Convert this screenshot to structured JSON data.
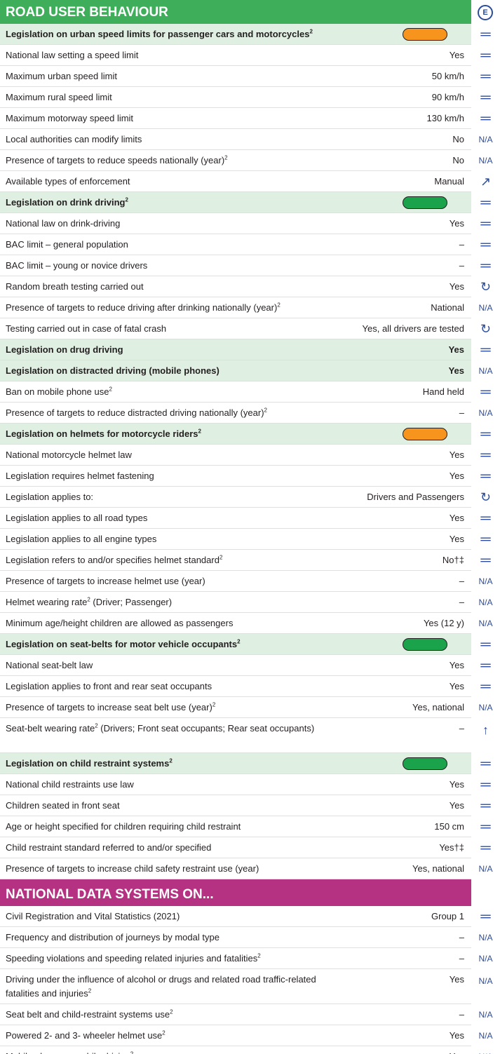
{
  "section1": {
    "title": "ROAD USER BEHAVIOUR",
    "badge": "E",
    "rows": [
      {
        "label": "Legislation on urban speed limits for passenger cars and motorcycles",
        "sup": "2",
        "value": "",
        "header": true,
        "pill": "#f7941d",
        "trend": "eq"
      },
      {
        "label": "National law setting a speed limit",
        "value": "Yes",
        "trend": "eq"
      },
      {
        "label": "Maximum urban speed limit",
        "value": "50 km/h",
        "trend": "eq"
      },
      {
        "label": "Maximum rural speed limit",
        "value": "90 km/h",
        "trend": "eq"
      },
      {
        "label": "Maximum motorway speed limit",
        "value": "130 km/h",
        "trend": "eq"
      },
      {
        "label": "Local authorities can modify limits",
        "value": "No",
        "trend": "na"
      },
      {
        "label": "Presence of targets to reduce speeds nationally (year)",
        "sup": "2",
        "value": "No",
        "trend": "na"
      },
      {
        "label": "Available types of enforcement",
        "value": "Manual",
        "trend": "diag"
      },
      {
        "label": "Legislation on drink driving",
        "sup": "2",
        "value": "",
        "header": true,
        "pill": "#1aa34a",
        "trend": "eq"
      },
      {
        "label": "National law on drink-driving",
        "value": "Yes",
        "trend": "eq"
      },
      {
        "label": "BAC limit – general population",
        "value": "–",
        "trend": "eq"
      },
      {
        "label": "BAC limit – young or novice drivers",
        "value": "–",
        "trend": "eq"
      },
      {
        "label": "Random breath testing carried out",
        "value": "Yes",
        "trend": "cycle"
      },
      {
        "label": "Presence of targets to reduce driving after drinking nationally (year)",
        "sup": "2",
        "value": "National",
        "trend": "na"
      },
      {
        "label": "Testing carried out in case of fatal crash",
        "value": "Yes, all drivers are tested",
        "trend": "cycle"
      },
      {
        "label": "Legislation on drug driving",
        "value": "Yes",
        "header": true,
        "trend": "eq"
      },
      {
        "label": "Legislation on distracted driving (mobile phones)",
        "value": "Yes",
        "header": true,
        "trend": "na"
      },
      {
        "label": "Ban on mobile phone use",
        "sup": "2",
        "value": "Hand held",
        "trend": "eq"
      },
      {
        "label": "Presence of targets to reduce distracted driving nationally (year)",
        "sup": "2",
        "value": "–",
        "trend": "na"
      },
      {
        "label": "Legislation on helmets for motorcycle riders",
        "sup": "2",
        "value": "",
        "header": true,
        "pill": "#f7941d",
        "trend": "eq"
      },
      {
        "label": "National motorcycle helmet law",
        "value": "Yes",
        "trend": "eq"
      },
      {
        "label": "Legislation requires helmet fastening",
        "value": "Yes",
        "trend": "eq"
      },
      {
        "label": "Legislation applies to:",
        "value": "Drivers and Passengers",
        "trend": "cycle"
      },
      {
        "label": "Legislation applies to all road types",
        "value": "Yes",
        "trend": "eq"
      },
      {
        "label": "Legislation applies to all engine types",
        "value": "Yes",
        "trend": "eq"
      },
      {
        "label": "Legislation refers to and/or specifies helmet standard",
        "sup": "2",
        "value": "No†‡",
        "trend": "eq"
      },
      {
        "label": "Presence of targets to increase helmet use (year)",
        "value": "–",
        "trend": "na"
      },
      {
        "label": "Helmet wearing rate",
        "sup": "2",
        "labelTail": " (Driver; Passenger)",
        "value": "–",
        "trend": "na"
      },
      {
        "label": "Minimum age/height children are allowed as passengers",
        "value": "Yes (12 y)",
        "trend": "na"
      },
      {
        "label": "Legislation on seat-belts for motor vehicle occupants",
        "sup": "2",
        "value": "",
        "header": true,
        "pill": "#1aa34a",
        "trend": "eq"
      },
      {
        "label": "National seat-belt law",
        "value": "Yes",
        "trend": "eq"
      },
      {
        "label": "Legislation applies to front and rear seat occupants",
        "value": "Yes",
        "trend": "eq"
      },
      {
        "label": "Presence of targets to increase seat belt use (year)",
        "sup": "2",
        "value": "Yes, national",
        "trend": "na"
      },
      {
        "label": "Seat-belt wearing rate",
        "sup": "2",
        "labelTail": " (Drivers; Front seat occupants; Rear seat occupants)",
        "value": "–",
        "trend": "up",
        "multi": true
      },
      {
        "label": "Legislation on child restraint systems",
        "sup": "2",
        "value": "",
        "header": true,
        "pill": "#1aa34a",
        "trend": "eq"
      },
      {
        "label": "National child restraints use law",
        "value": "Yes",
        "trend": "eq"
      },
      {
        "label": "Children seated in front seat",
        "value": "Yes",
        "trend": "eq"
      },
      {
        "label": "Age or height specified for children requiring child restraint",
        "value": "150 cm",
        "trend": "eq"
      },
      {
        "label": "Child restraint standard referred to and/or specified",
        "value": "Yes†‡",
        "trend": "eq"
      },
      {
        "label": "Presence of targets to increase child safety restraint use (year)",
        "value": "Yes, national",
        "trend": "na"
      }
    ]
  },
  "section2": {
    "title": "NATIONAL DATA SYSTEMS ON...",
    "rows": [
      {
        "label": "Civil Registration and Vital Statistics (2021)",
        "value": "Group 1",
        "trend": "eq"
      },
      {
        "label": "Frequency and distribution of journeys by modal type",
        "value": "–",
        "trend": "na"
      },
      {
        "label": "Speeding violations and speeding related injuries and fatalities",
        "sup": "2",
        "value": "–",
        "trend": "na"
      },
      {
        "label": "Driving under the influence of alcohol or drugs  and related road traffic-related fatalities and injuries",
        "sup": "2",
        "value": "Yes",
        "trend": "na",
        "multi": true
      },
      {
        "label": "Seat belt and child-restraint systems use",
        "sup": "2",
        "value": "–",
        "trend": "na"
      },
      {
        "label": "Powered 2- and 3- wheeler helmet use",
        "sup": "2",
        "value": "Yes",
        "trend": "na"
      },
      {
        "label": "Mobile phone use while driving",
        "sup": "2",
        "value": "Yes",
        "trend": "na"
      }
    ]
  },
  "trend_symbols": {
    "eq": "═",
    "na": "N/A",
    "diag": "↗",
    "cycle": "↻",
    "up": "↑"
  },
  "colors": {
    "green": "#3fae5a",
    "pink": "#b43281",
    "pale_green": "#dff0e3",
    "orange": "#f7941d",
    "dark_green": "#1aa34a",
    "trend_blue": "#2b4c9b"
  }
}
